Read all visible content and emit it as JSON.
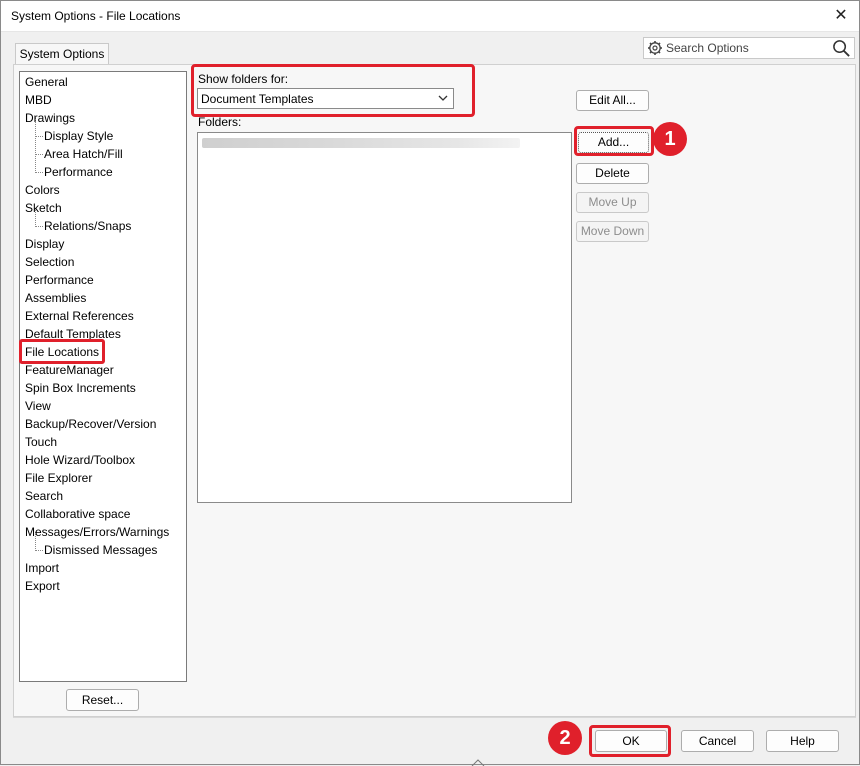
{
  "window": {
    "title": "System Options - File Locations",
    "close_glyph": "✕"
  },
  "tabs": [
    {
      "label": "System Options",
      "active": true
    }
  ],
  "search": {
    "placeholder": "Search Options",
    "gear_icon": "gear-icon",
    "magnifier_icon": "search-icon"
  },
  "tree": {
    "items": [
      {
        "label": "General",
        "level": 0
      },
      {
        "label": "MBD",
        "level": 0
      },
      {
        "label": "Drawings",
        "level": 0
      },
      {
        "label": "Display Style",
        "level": 1
      },
      {
        "label": "Area Hatch/Fill",
        "level": 1
      },
      {
        "label": "Performance",
        "level": 1
      },
      {
        "label": "Colors",
        "level": 0
      },
      {
        "label": "Sketch",
        "level": 0
      },
      {
        "label": "Relations/Snaps",
        "level": 1
      },
      {
        "label": "Display",
        "level": 0
      },
      {
        "label": "Selection",
        "level": 0
      },
      {
        "label": "Performance",
        "level": 0
      },
      {
        "label": "Assemblies",
        "level": 0
      },
      {
        "label": "External References",
        "level": 0
      },
      {
        "label": "Default Templates",
        "level": 0
      },
      {
        "label": "File Locations",
        "level": 0,
        "selected": true
      },
      {
        "label": "FeatureManager",
        "level": 0
      },
      {
        "label": "Spin Box Increments",
        "level": 0
      },
      {
        "label": "View",
        "level": 0
      },
      {
        "label": "Backup/Recover/Version",
        "level": 0
      },
      {
        "label": "Touch",
        "level": 0
      },
      {
        "label": "Hole Wizard/Toolbox",
        "level": 0
      },
      {
        "label": "File Explorer",
        "level": 0
      },
      {
        "label": "Search",
        "level": 0
      },
      {
        "label": "Collaborative space",
        "level": 0
      },
      {
        "label": "Messages/Errors/Warnings",
        "level": 0
      },
      {
        "label": "Dismissed Messages",
        "level": 1
      },
      {
        "label": "Import",
        "level": 0
      },
      {
        "label": "Export",
        "level": 0
      }
    ]
  },
  "reset_button": "Reset...",
  "show_folders_for": {
    "label": "Show folders for:",
    "selected": "Document Templates"
  },
  "folders": {
    "label": "Folders:"
  },
  "side_buttons": {
    "edit_all": "Edit All...",
    "add": "Add...",
    "delete": "Delete",
    "move_up": "Move Up",
    "move_down": "Move Down"
  },
  "footer_buttons": {
    "ok": "OK",
    "cancel": "Cancel",
    "help": "Help"
  },
  "annotations": {
    "step1": "1",
    "step2": "2",
    "highlight_color": "#e0202b"
  }
}
